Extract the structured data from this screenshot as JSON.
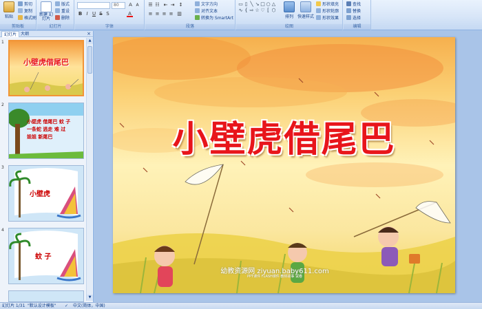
{
  "ribbon": {
    "clipboard": {
      "group_label": "剪贴板",
      "paste": "粘贴",
      "cut": "剪切",
      "copy": "复制",
      "format_painter": "格式刷"
    },
    "slides": {
      "group_label": "幻灯片",
      "new_slide": "新建\n幻灯片",
      "layout": "版式",
      "reset": "重设",
      "delete": "删除"
    },
    "font": {
      "group_label": "字体",
      "font_name": "",
      "font_size": "80"
    },
    "paragraph": {
      "group_label": "段落",
      "text_direction": "文字方向",
      "align_text": "对齐文本",
      "convert_smartart": "转换为 SmartArt"
    },
    "drawing": {
      "group_label": "绘图",
      "arrange": "排列",
      "quick_styles": "快速样式",
      "shape_fill": "形状填充",
      "shape_outline": "形状轮廓",
      "shape_effects": "形状效果"
    },
    "editing": {
      "group_label": "编辑",
      "find": "查找",
      "replace": "替换",
      "select": "选择"
    }
  },
  "left_panel": {
    "tab_slides": "幻灯片",
    "tab_outline": "大纲",
    "close": "×",
    "slide_numbers": [
      "1",
      "2",
      "3",
      "4"
    ],
    "thumbs": {
      "t1_title": "小壁虎借尾巴",
      "t2_lines": [
        "小壁虎  借尾巴  蚊 子",
        "一条蛇  逃走   难 过",
        "姐姐  新尾巴"
      ],
      "t3_word": "小壁虎",
      "t4_word": "蚊 子"
    }
  },
  "slide": {
    "title": "小壁虎借尾巴",
    "watermark": "幼教资源网 ziyuan.baby611.com",
    "watermark_sub": "PPT课件  FLASH课件  教师故事  试卷"
  },
  "statusbar": {
    "slide_info": "幻灯片 1/31",
    "theme": "\"默认设计模板\"",
    "language": "中文(简体，中国)"
  },
  "colors": {
    "title_red": "#e8151b",
    "ribbon_bg": "#d8e6f8",
    "app_bg": "#a9c4e8",
    "selected_border": "#f29436"
  }
}
